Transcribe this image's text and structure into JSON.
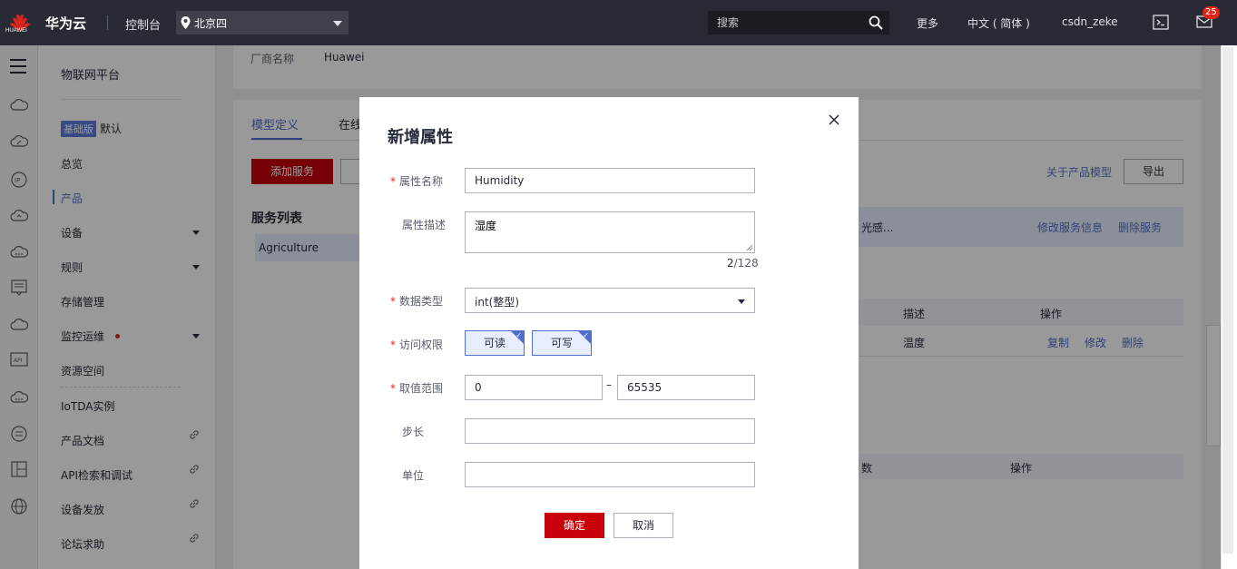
{
  "topbar": {
    "logo_text": "HUAWEI",
    "brand": "华为云",
    "console": "控制台",
    "region": "北京四",
    "search_placeholder": "搜索",
    "more": "更多",
    "language": "中文 ( 简体 )",
    "username": "csdn_zeke",
    "message_count": "25"
  },
  "sidebar": {
    "title": "物联网平台",
    "edition_tag": "基础版",
    "edition_label": "默认",
    "items": [
      {
        "label": "总览"
      },
      {
        "label": "产品"
      },
      {
        "label": "设备"
      },
      {
        "label": "规则"
      },
      {
        "label": "存储管理"
      },
      {
        "label": "监控运维"
      },
      {
        "label": "资源空间"
      },
      {
        "label": "IoTDA实例"
      },
      {
        "label": "产品文档"
      },
      {
        "label": "API检索和调试"
      },
      {
        "label": "设备发放"
      },
      {
        "label": "论坛求助"
      }
    ]
  },
  "main": {
    "vendor_label": "厂商名称",
    "vendor_value": "Huawei",
    "tab_model": "模型定义",
    "tab_online": "在线",
    "add_service": "添加服务",
    "about_model": "关于产品模型",
    "export": "导出",
    "service_list": "服务列表",
    "service_item": "Agriculture",
    "service_desc": "光感...",
    "modify_service": "修改服务信息",
    "delete_service": "删除服务",
    "col_desc": "描述",
    "col_ops": "操作",
    "row_desc": "温度",
    "op_copy": "复制",
    "op_edit": "修改",
    "op_delete": "删除",
    "col_params": "数",
    "col_ops2": "操作"
  },
  "dialog": {
    "title": "新增属性",
    "name_label": "属性名称",
    "name_value": "Humidity",
    "desc_label": "属性描述",
    "desc_value": "湿度",
    "desc_count": "2",
    "desc_max": "/128",
    "type_label": "数据类型",
    "type_value": "int(整型)",
    "access_label": "访问权限",
    "access_read": "可读",
    "access_write": "可写",
    "range_label": "取值范围",
    "range_min": "0",
    "range_sep": "–",
    "range_max": "65535",
    "step_label": "步长",
    "step_value": "",
    "unit_label": "单位",
    "unit_value": "",
    "ok": "确定",
    "cancel": "取消"
  }
}
